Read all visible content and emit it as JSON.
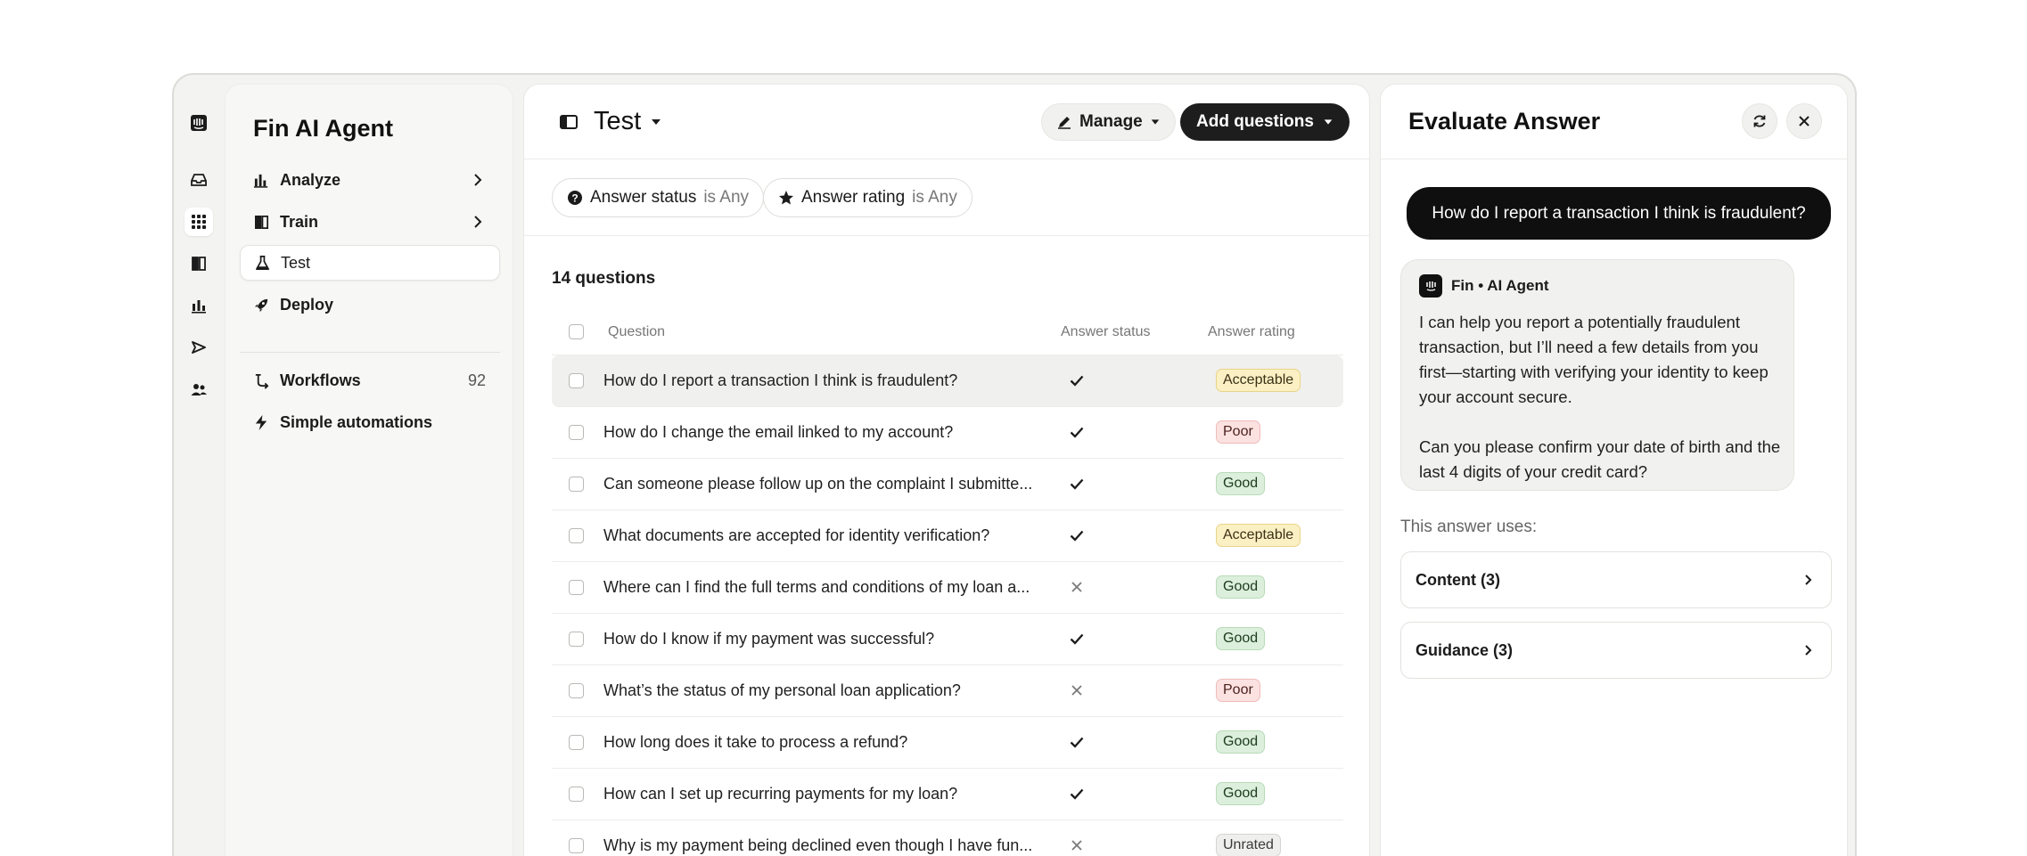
{
  "sidebar": {
    "title": "Fin AI Agent",
    "items": [
      {
        "label": "Analyze",
        "icon": "bar-chart-icon"
      },
      {
        "label": "Train",
        "icon": "book-icon"
      },
      {
        "label": "Test",
        "icon": "flask-icon"
      },
      {
        "label": "Deploy",
        "icon": "rocket-icon"
      }
    ],
    "secondary": [
      {
        "label": "Workflows",
        "count": "92",
        "icon": "workflow-icon"
      },
      {
        "label": "Simple automations",
        "icon": "lightning-icon"
      }
    ]
  },
  "main": {
    "title": "Test",
    "manage_label": "Manage",
    "add_label": "Add questions",
    "filters": [
      {
        "label": "Answer status",
        "op": "is Any"
      },
      {
        "label": "Answer rating",
        "op": "is Any"
      }
    ],
    "count_label": "14 questions",
    "columns": {
      "question": "Question",
      "status": "Answer status",
      "rating": "Answer rating"
    },
    "rows": [
      {
        "question": "How do I report a transaction I think is fraudulent?",
        "status": "check",
        "rating": "Acceptable"
      },
      {
        "question": "How do I change the email linked to my account?",
        "status": "check",
        "rating": "Poor"
      },
      {
        "question": "Can someone please follow up on the complaint I submitte...",
        "status": "check",
        "rating": "Good"
      },
      {
        "question": "What documents are accepted for identity verification?",
        "status": "check",
        "rating": "Acceptable"
      },
      {
        "question": "Where can I find the full terms and conditions of my loan a...",
        "status": "cross",
        "rating": "Good"
      },
      {
        "question": "How do I know if my payment was successful?",
        "status": "check",
        "rating": "Good"
      },
      {
        "question": "What’s the status of my personal loan application?",
        "status": "cross",
        "rating": "Poor"
      },
      {
        "question": "How long does it take to process a refund?",
        "status": "check",
        "rating": "Good"
      },
      {
        "question": "How can I set up recurring payments for my loan?",
        "status": "check",
        "rating": "Good"
      },
      {
        "question": "Why is my payment being declined even though I have fun...",
        "status": "cross",
        "rating": "Unrated"
      }
    ]
  },
  "evaluate": {
    "title": "Evaluate Answer",
    "user_message": "How do I report a transaction I think is fraudulent?",
    "agent_name": "Fin • AI Agent",
    "agent_paragraphs": [
      "I can help you report a potentially fraudulent transaction, but I’ll need a few details from you first—starting with verifying your identity to keep your account secure.",
      "Can you please confirm your date of birth and the last 4 digits of your credit card?"
    ],
    "uses_label": "This answer uses:",
    "sources": [
      {
        "label": "Content (3)"
      },
      {
        "label": "Guidance (3)"
      }
    ]
  },
  "colors": {
    "accent_dark": "#1d1d1d",
    "acceptable": "#fbf0c4",
    "poor": "#fbe2e1",
    "good": "#dcefdc",
    "unrated": "#efefed"
  }
}
